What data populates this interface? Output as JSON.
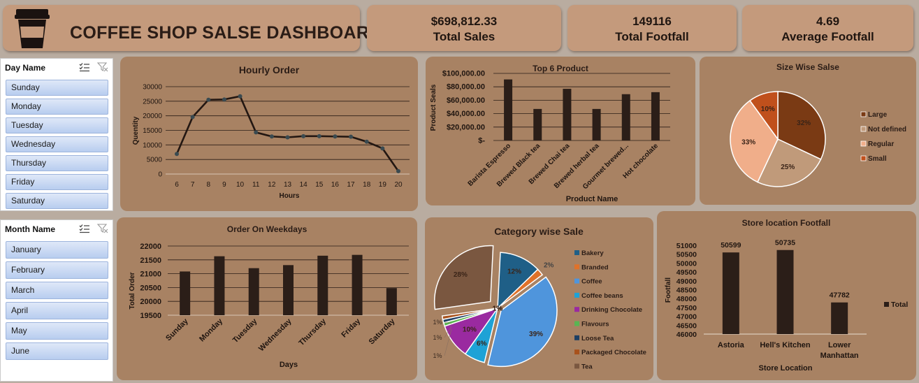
{
  "header": {
    "title": "COFFEE SHOP SALSE DASHBOARD",
    "logo_icon": "coffee-cup-icon"
  },
  "kpis": [
    {
      "value": "$698,812.33",
      "label": "Total Sales"
    },
    {
      "value": "149116",
      "label": "Total Footfall"
    },
    {
      "value": "4.69",
      "label": "Average Footfall"
    }
  ],
  "slicers": {
    "day": {
      "title": "Day Name",
      "items": [
        "Sunday",
        "Monday",
        "Tuesday",
        "Wednesday",
        "Thursday",
        "Friday",
        "Saturday"
      ]
    },
    "month": {
      "title": "Month Name",
      "items": [
        "January",
        "February",
        "March",
        "April",
        "May",
        "June"
      ]
    }
  },
  "colors": {
    "background": "#b9aca0",
    "card": "#c49a7c",
    "panel": "#a88263",
    "bar": "#2b1e18"
  },
  "chart_data": [
    {
      "id": "hourly",
      "type": "line",
      "title": "Hourly Order",
      "xlabel": "Hours",
      "ylabel": "Quentity",
      "x": [
        6,
        7,
        8,
        9,
        10,
        11,
        12,
        13,
        14,
        15,
        16,
        17,
        18,
        19,
        20
      ],
      "values": [
        6900,
        19600,
        25500,
        25600,
        26700,
        14300,
        12900,
        12600,
        13000,
        13000,
        12900,
        12800,
        11100,
        8800,
        1000
      ],
      "ylim": [
        0,
        30000
      ],
      "yticks": [
        "0",
        "5000",
        "10000",
        "15000",
        "20000",
        "25000",
        "30000"
      ],
      "grid": true
    },
    {
      "id": "top6",
      "type": "bar",
      "title": "Top 6 Product",
      "xlabel": "Product Name",
      "ylabel": "Product Seals",
      "categories": [
        "Barista Espresso",
        "Brewed Black tea",
        "Brewed Chai tea",
        "Brewed herbal tea",
        "Gourmet brewed...",
        "Hot chocolate"
      ],
      "values": [
        91000,
        47000,
        77000,
        47000,
        69000,
        72000
      ],
      "ylim": [
        0,
        100000
      ],
      "yticks": [
        "$-",
        "$20,000.00",
        "$40,000.00",
        "$60,000.00",
        "$80,000.00",
        "$100,000.00"
      ],
      "grid": true
    },
    {
      "id": "size",
      "type": "pie",
      "title": "Size Wise Salse",
      "categories": [
        "Large",
        "Not defined",
        "Regular",
        "Small"
      ],
      "values": [
        32,
        25,
        33,
        10
      ],
      "labels": [
        "32%",
        "25%",
        "33%",
        "10%"
      ],
      "colors": [
        "#7a3a14",
        "#c09a7a",
        "#f0ae8a",
        "#c0501c"
      ],
      "legend": "right"
    },
    {
      "id": "weekdays",
      "type": "bar",
      "title": "Order On Weekdays",
      "xlabel": "Days",
      "ylabel": "Total Order",
      "categories": [
        "Sunday",
        "Monday",
        "Tuesday",
        "Wednesday",
        "Thursday",
        "Friday",
        "Saturday"
      ],
      "values": [
        21080,
        21630,
        21200,
        21310,
        21650,
        21680,
        20480
      ],
      "ylim": [
        19500,
        22000
      ],
      "yticks": [
        "19500",
        "20000",
        "20500",
        "21000",
        "21500",
        "22000"
      ],
      "grid": true
    },
    {
      "id": "category",
      "type": "pie",
      "title": "Category wise Sale",
      "categories": [
        "Bakery",
        "Branded",
        "Coffee",
        "Coffee beans",
        "Drinking Chocolate",
        "Flavours",
        "Loose Tea",
        "Packaged Chocolate",
        "Tea"
      ],
      "values": [
        12,
        2,
        39,
        6,
        10,
        1,
        1,
        1,
        28
      ],
      "labels": [
        "12%",
        "2%",
        "39%",
        "6%",
        "10%",
        "1%",
        "1%",
        "1%",
        "28%"
      ],
      "colors": [
        "#1f5f87",
        "#e0722a",
        "#4f95dc",
        "#1ea2d6",
        "#9a2aa0",
        "#5ab552",
        "#1e3f63",
        "#a8521c",
        "#7a5740"
      ],
      "legend": "right"
    },
    {
      "id": "store",
      "type": "bar",
      "title": "Store location Footfall",
      "xlabel": "Store Location",
      "ylabel": "Footfall",
      "categories": [
        "Astoria",
        "Hell's Kitchen",
        "Lower Manhattan"
      ],
      "values": [
        50599,
        50735,
        47782
      ],
      "data_labels": [
        "50599",
        "50735",
        "47782"
      ],
      "series": [
        {
          "name": "Total",
          "values": [
            50599,
            50735,
            47782
          ]
        }
      ],
      "ylim": [
        46000,
        51000
      ],
      "yticks": [
        "46000",
        "46500",
        "47000",
        "47500",
        "48000",
        "48500",
        "49000",
        "49500",
        "50000",
        "50500",
        "51000"
      ],
      "grid": false,
      "legend": "right"
    }
  ]
}
